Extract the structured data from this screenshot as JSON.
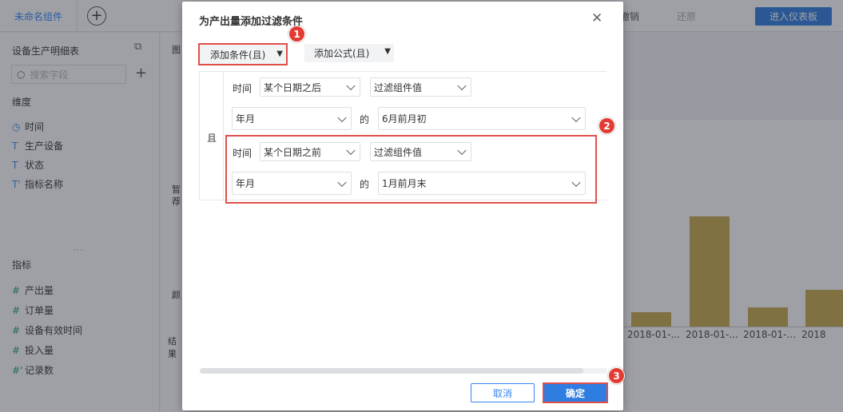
{
  "topbar": {
    "active_tab": "未命名组件",
    "add_tab": "+",
    "undo": "撤销",
    "redo": "还原",
    "enter_dashboard": "进入仪表板"
  },
  "left_panel": {
    "title": "设备生产明细表",
    "search_placeholder": "搜索字段",
    "dimension_title": "维度",
    "dimensions": [
      {
        "icon": "◷",
        "label": "时间"
      },
      {
        "icon": "T",
        "label": "生产设备"
      },
      {
        "icon": "T",
        "label": "状态"
      },
      {
        "icon": "T'",
        "label": "指标名称"
      }
    ],
    "measure_title": "指标",
    "measures": [
      {
        "icon": "#",
        "label": "产出量"
      },
      {
        "icon": "#",
        "label": "订单量"
      },
      {
        "icon": "#",
        "label": "设备有效时间"
      },
      {
        "icon": "#",
        "label": "投入量"
      },
      {
        "icon": "#'",
        "label": "记录数"
      }
    ]
  },
  "mid_panel": {
    "chart_label": "图",
    "hint_1": "暂",
    "hint_2": "荐",
    "color_label": "颜",
    "result_label": "结果"
  },
  "chart": {
    "x_ticks": [
      "2018-01-...",
      "2018-01-...",
      "2018-01-...",
      "2018"
    ]
  },
  "dialog": {
    "title": "为产出量添加过滤条件",
    "close": "✕",
    "add_condition": "添加条件(且)",
    "add_formula": "添加公式(且)",
    "caret": "▼",
    "and_label": "且",
    "conditions": [
      {
        "field": "时间",
        "operator": "某个日期之后",
        "value_type": "过滤组件值",
        "unit": "年月",
        "of": "的",
        "value": "6月前月初"
      },
      {
        "field": "时间",
        "operator": "某个日期之前",
        "value_type": "过滤组件值",
        "unit": "年月",
        "of": "的",
        "value": "1月前月末"
      }
    ],
    "cancel": "取消",
    "confirm": "确定"
  },
  "markers": [
    "1",
    "2",
    "3"
  ],
  "colors": {
    "primary": "#2f7de1",
    "highlight": "#e0504b",
    "bar": "#c9a94b"
  }
}
